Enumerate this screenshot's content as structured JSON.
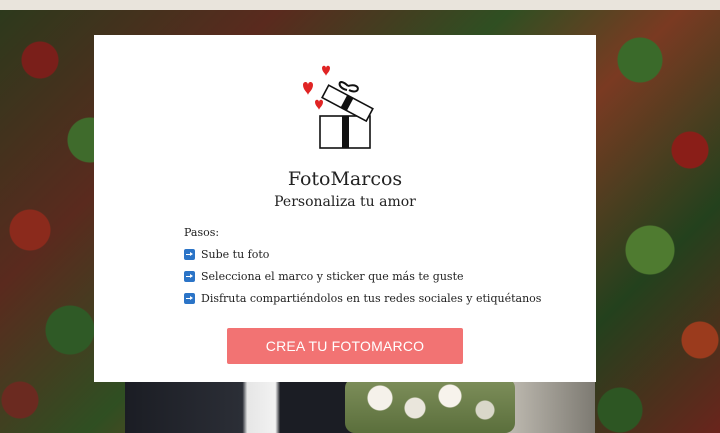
{
  "hero": {
    "app_title": "FotoMarcos",
    "subtitle": "Personaliza tu amor"
  },
  "steps": {
    "heading": "Pasos:",
    "items": [
      {
        "label": "Sube tu foto",
        "icon": "right-arrow-icon"
      },
      {
        "label": "Selecciona el marco y sticker que más te guste",
        "icon": "right-arrow-icon"
      },
      {
        "label": "Disfruta compartiéndolos en tus redes sociales y etiquétanos",
        "icon": "right-arrow-icon"
      }
    ]
  },
  "cta": {
    "label": "CREA TU FOTOMARCO"
  },
  "colors": {
    "cta_bg": "#f27373",
    "arrow_bg": "#2b74c7",
    "heart": "#e02424"
  }
}
